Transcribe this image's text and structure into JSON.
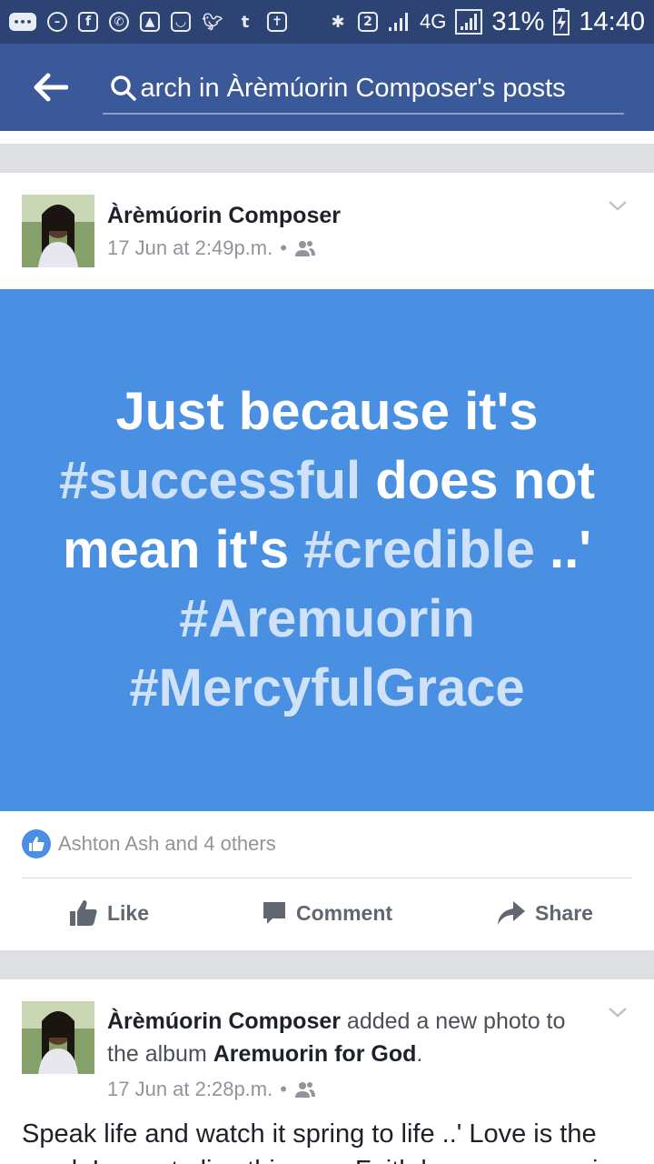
{
  "status_bar": {
    "left_icons": [
      "chat-bubble-icon",
      "minus-circle-icon",
      "facebook-icon",
      "whatsapp-icon",
      "gallery-icon",
      "galaxy-icon",
      "twitter-icon",
      "tumblr-icon",
      "holy-bible-icon"
    ],
    "sim_label": "2",
    "network": "4G",
    "battery": "31%",
    "time": "14:40"
  },
  "search": {
    "text": "arch in Àrèmúorin Composer's posts"
  },
  "posts": [
    {
      "author": "Àrèmúorin Composer",
      "timestamp": "17 Jun at 2:49p.m.",
      "separator": "•",
      "color_post": {
        "line1": "Just because it's",
        "tag1": "#successful",
        "text2": " does not",
        "text3": "mean it's ",
        "tag2": "#credible",
        "text4": " ..'",
        "tag3": "#Aremuorin",
        "tag4": "#MercyfulGrace"
      },
      "reactions": "Ashton Ash and 4 others",
      "actions": {
        "like": "Like",
        "comment": "Comment",
        "share": "Share"
      }
    },
    {
      "author": "Àrèmúorin Composer",
      "activity_pre": " added a new photo to the album ",
      "album": "Aremuorin for God",
      "activity_post": ".",
      "timestamp": "17 Jun at 2:28p.m.",
      "separator": "•",
      "body": "Speak life and watch it spring to life ..' Love is the mask I wear to live this way. Faith keeps me moving"
    }
  ],
  "colors": {
    "header": "#3b5998",
    "status_bar": "#2d4373",
    "post_background": "#4a90e2"
  }
}
